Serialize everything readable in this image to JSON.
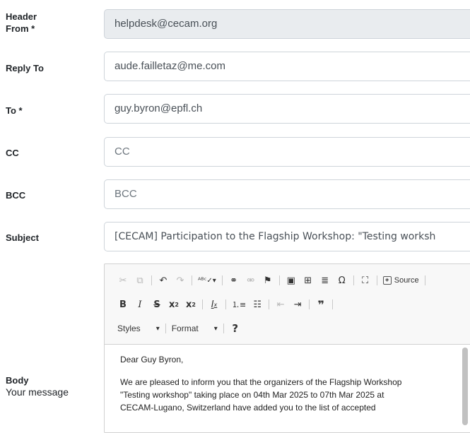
{
  "form": {
    "header_from": {
      "label": "Header",
      "label2": "From *",
      "value": "helpdesk@cecam.org"
    },
    "reply_to": {
      "label": "Reply To",
      "value": "aude.failletaz@me.com"
    },
    "to": {
      "label": "To *",
      "value": "guy.byron@epfl.ch"
    },
    "cc": {
      "label": "CC",
      "placeholder": "CC"
    },
    "bcc": {
      "label": "BCC",
      "placeholder": "BCC"
    },
    "subject": {
      "label": "Subject",
      "value": "[CECAM] Participation to the Flagship Workshop: \"Testing worksh"
    },
    "body": {
      "label": "Body",
      "sublabel": "Your message"
    }
  },
  "editor": {
    "toolbar1": [
      "cut-icon",
      "copy-icon",
      "undo-icon",
      "redo-icon",
      "spellcheck-icon",
      "link-icon",
      "unlink-icon",
      "anchor-icon",
      "image-icon",
      "table-icon",
      "horizontal-line-icon",
      "special-char-icon",
      "maximize-icon"
    ],
    "source_label": "Source",
    "toolbar2": [
      "bold-icon",
      "italic-icon",
      "strike-icon",
      "subscript-icon",
      "superscript-icon",
      "remove-format-icon",
      "numbered-list-icon",
      "bullet-list-icon",
      "outdent-icon",
      "indent-icon",
      "blockquote-icon"
    ],
    "styles_label": "Styles",
    "format_label": "Format",
    "help_label": "?",
    "content": {
      "greeting": "Dear Guy Byron,",
      "line1": "We are pleased to inform you that the organizers of the Flagship Workshop",
      "line2": "\"Testing workshop\" taking place on 04th Mar 2025 to 07th Mar 2025 at",
      "line3": "CECAM-Lugano, Switzerland have added you to the list of accepted"
    }
  }
}
